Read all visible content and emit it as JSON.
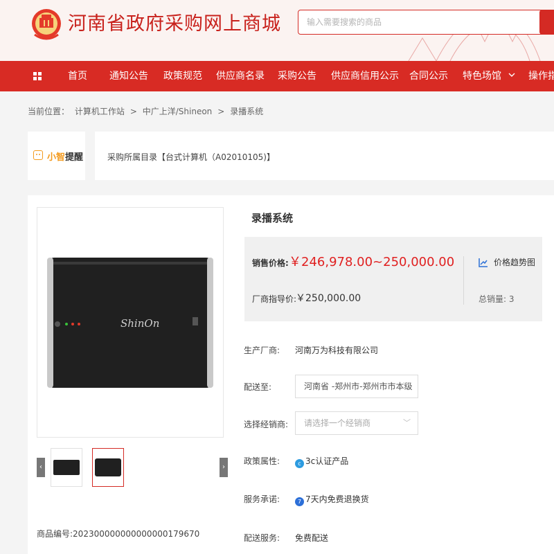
{
  "header": {
    "site_title": "河南省政府采购网上商城",
    "search_placeholder": "输入需要搜索的商品",
    "brand_color": "#d82b24"
  },
  "nav": {
    "menu_icon": "grid-icon",
    "items": [
      "首页",
      "通知公告",
      "政策规范",
      "供应商名录",
      "采购公告",
      "供应商信用公示",
      "合同公示",
      "特色场馆",
      "操作指"
    ]
  },
  "breadcrumb": {
    "prefix": "当前位置：",
    "items": [
      "计算机工作站",
      "中广上洋/Shineon",
      "录播系统"
    ]
  },
  "reminder": {
    "tag_a": "小智",
    "tag_b": "提醒",
    "text": "采购所属目录【台式计算机（A02010105)】"
  },
  "product": {
    "title": "录播系统",
    "sale_price_label": "销售价格:",
    "sale_price": "￥246,978.00~250,000.00",
    "guide_price_label": "厂商指导价:",
    "guide_price": "￥250,000.00",
    "trend_label": "价格趋势图",
    "sold_label": "总销量:",
    "sold_value": "3",
    "manufacturer_label": "生产厂商:",
    "manufacturer": "河南万为科技有限公司",
    "delivery_to_label": "配送至:",
    "delivery_to": "河南省 -郑州市-郑州市市本级",
    "dealer_label": "选择经销商:",
    "dealer_placeholder": "请选择一个经销商",
    "policy_label": "政策属性:",
    "policy": "3c认证产品",
    "promise_label": "服务承诺:",
    "promise": "7天内免费退换货",
    "delivery_service_label": "配送服务:",
    "delivery_service": "免费配送",
    "sku_label": "商品编号:",
    "sku": "202300000000000000179670",
    "device_label": "ShinOn",
    "price_color": "#e02020"
  }
}
